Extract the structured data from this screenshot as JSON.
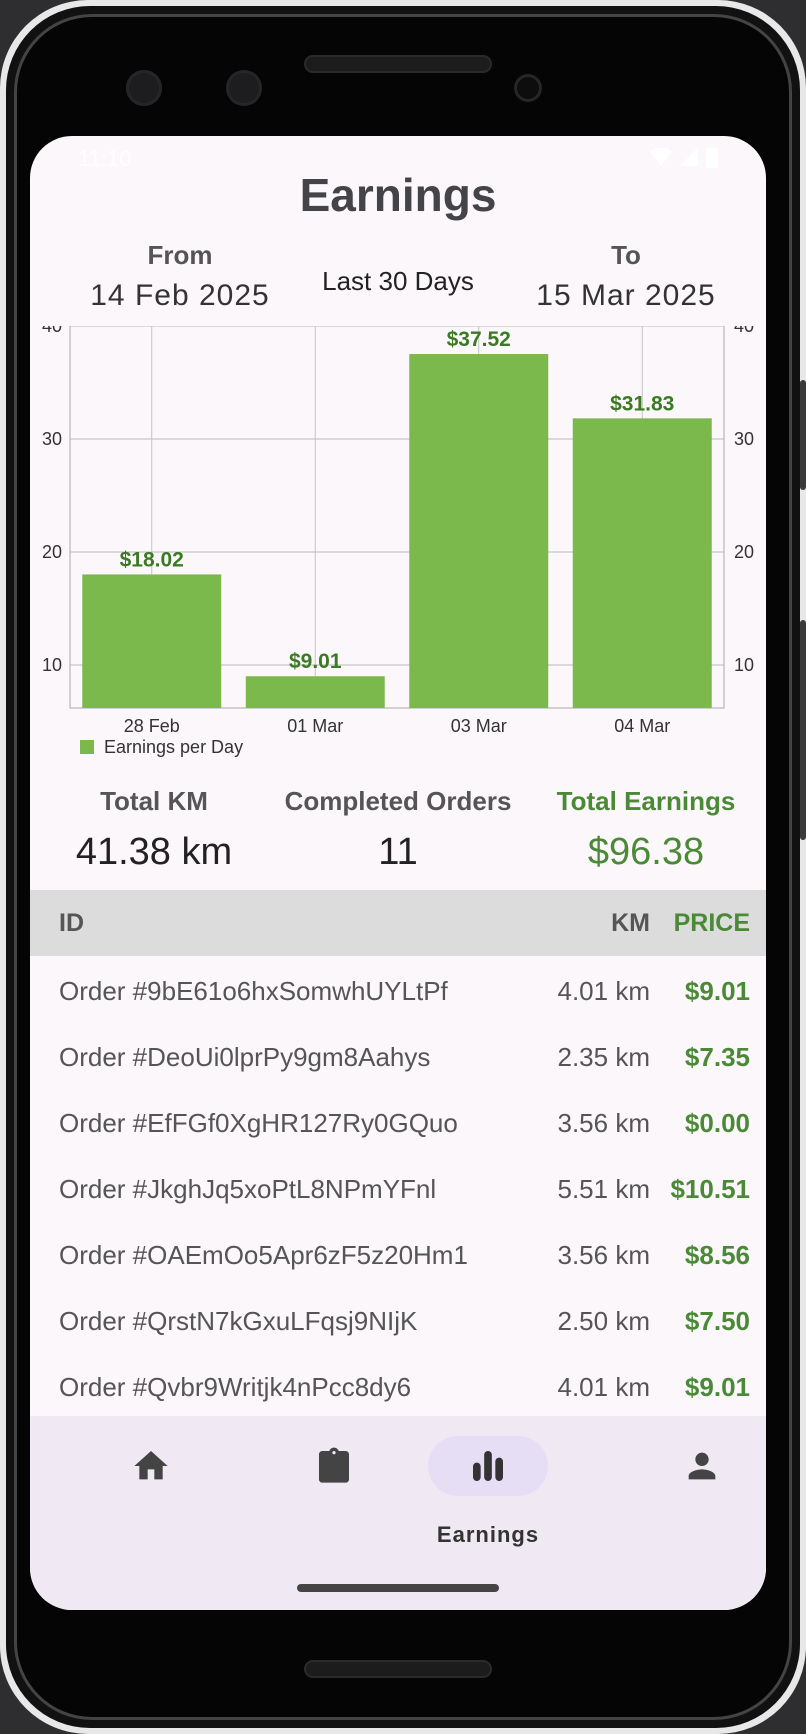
{
  "status": {
    "time": "11:10"
  },
  "header": {
    "title": "Earnings"
  },
  "range": {
    "from_label": "From",
    "from_value": "14 Feb 2025",
    "preset": "Last 30 Days",
    "to_label": "To",
    "to_value": "15 Mar 2025"
  },
  "chart_data": {
    "type": "bar",
    "categories": [
      "28 Feb",
      "01 Mar",
      "03 Mar",
      "04 Mar"
    ],
    "values": [
      18.02,
      9.01,
      37.52,
      31.83
    ],
    "value_labels": [
      "$18.02",
      "$9.01",
      "$37.52",
      "$31.83"
    ],
    "series": [
      {
        "name": "Earnings per Day",
        "values": [
          18.02,
          9.01,
          37.52,
          31.83
        ]
      }
    ],
    "legend": "Earnings per Day",
    "ylim": [
      6.2,
      40
    ],
    "yticks": [
      10,
      20,
      30,
      40
    ],
    "grid": true,
    "legend_position": "bottom-left",
    "bar_color": "#7cb94c",
    "label_color": "#3b7a24"
  },
  "stats": {
    "km_label": "Total KM",
    "km_value": "41.38 km",
    "orders_label": "Completed Orders",
    "orders_value": "11",
    "earnings_label": "Total Earnings",
    "earnings_value": "$96.38"
  },
  "table": {
    "headers": {
      "id": "ID",
      "km": "KM",
      "price": "PRICE"
    },
    "rows": [
      {
        "id": "Order #9bE61o6hxSomwhUYLtPf",
        "km": "4.01 km",
        "price": "$9.01"
      },
      {
        "id": "Order #DeoUi0lprPy9gm8Aahys",
        "km": "2.35 km",
        "price": "$7.35"
      },
      {
        "id": "Order #EfFGf0XgHR127Ry0GQuo",
        "km": "3.56 km",
        "price": "$0.00"
      },
      {
        "id": "Order #JkghJq5xoPtL8NPmYFnl",
        "km": "5.51 km",
        "price": "$10.51"
      },
      {
        "id": "Order #OAEmOo5Apr6zF5z20Hm1",
        "km": "3.56 km",
        "price": "$8.56"
      },
      {
        "id": "Order #QrstN7kGxuLFqsj9NIjK",
        "km": "2.50 km",
        "price": "$7.50"
      },
      {
        "id": "Order #Qvbr9Writjk4nPcc8dy6",
        "km": "4.01 km",
        "price": "$9.01"
      }
    ]
  },
  "nav": {
    "items": [
      {
        "icon": "home-icon",
        "label": ""
      },
      {
        "icon": "clipboard-icon",
        "label": ""
      },
      {
        "icon": "bar-chart-icon",
        "label": "Earnings"
      },
      {
        "icon": "person-icon",
        "label": ""
      }
    ]
  },
  "colors": {
    "accent": "#4a8a36",
    "bar": "#7cb94c",
    "nav_bg": "#f0e9f3",
    "active_pill": "#e6def5"
  }
}
